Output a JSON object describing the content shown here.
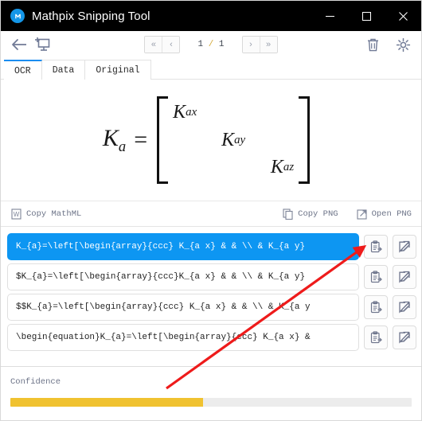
{
  "window": {
    "title": "Mathpix Snipping Tool",
    "logo_icon": "mathpix-logo-icon",
    "minimize_icon": "minimize-icon",
    "maximize_icon": "maximize-icon",
    "close_icon": "close-icon"
  },
  "toolbar": {
    "back_icon": "back-arrow-icon",
    "new_snip_icon": "new-snip-icon",
    "first_page_label": "«",
    "prev_page_label": "‹",
    "next_page_label": "›",
    "last_page_label": "»",
    "page_current": "1",
    "page_separator": "/",
    "page_total": "1",
    "delete_icon": "trash-icon",
    "settings_icon": "gear-icon"
  },
  "tabs": [
    {
      "label": "OCR",
      "active": true
    },
    {
      "label": "Data",
      "active": false
    },
    {
      "label": "Original",
      "active": false
    }
  ],
  "formula": {
    "lhs_base": "K",
    "lhs_sub": "a",
    "equals": "=",
    "entries": [
      {
        "base": "K",
        "sub": "ax"
      },
      {
        "base": "K",
        "sub": "ay"
      },
      {
        "base": "K",
        "sub": "az"
      }
    ]
  },
  "copybar": {
    "copy_mathml": "Copy MathML",
    "copy_mathml_icon": "word-document-icon",
    "copy_png": "Copy PNG",
    "copy_png_icon": "copy-pages-icon",
    "open_png": "Open PNG",
    "open_png_icon": "external-link-icon"
  },
  "results": {
    "copy_icon": "clipboard-copy-icon",
    "edit_icon": "edit-pencil-icon",
    "rows": [
      {
        "text": "K_{a}=\\left[\\begin{array}{ccc} K_{a x} & & \\\\ & K_{a y}",
        "selected": true
      },
      {
        "text": "$K_{a}=\\left[\\begin{array}{ccc}K_{a x} & & \\\\ & K_{a y}",
        "selected": false
      },
      {
        "text": "$$K_{a}=\\left[\\begin{array}{ccc} K_{a x} & & \\\\ & K_{a y",
        "selected": false
      },
      {
        "text": "\\begin{equation}K_{a}=\\left[\\begin{array}{ccc} K_{a x} &",
        "selected": false
      }
    ]
  },
  "confidence": {
    "label": "Confidence",
    "percent": 48,
    "fill_color": "#f0c230"
  },
  "annotation": {
    "arrow_color": "#ee1b1b"
  }
}
